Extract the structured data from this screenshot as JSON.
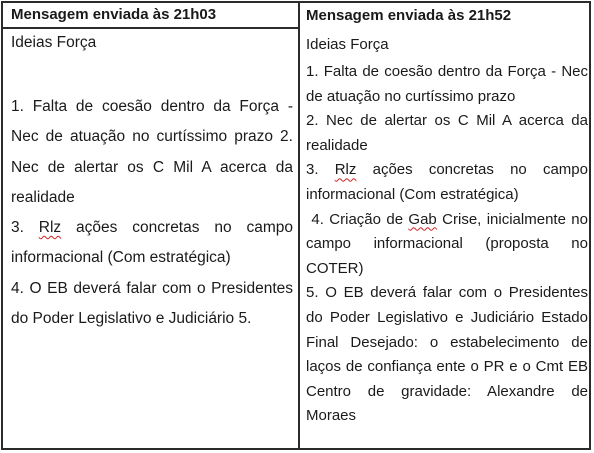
{
  "left_column": {
    "header": "Mensagem enviada às 21h03",
    "subtitle": "Ideias Força",
    "item_1_2": "1. Falta de coesão dentro da Força - Nec de atuação no curtíssimo prazo 2. Nec de alertar os C Mil A acerca da realidade",
    "item_3_prefix": "3. ",
    "item_3_squiggle": "Rlz",
    "item_3_rest": " ações concretas no campo informacional (Com estratégica)",
    "item_4": "4. O EB deverá falar com o Presidentes do Poder Legislativo e Judiciário 5."
  },
  "right_column": {
    "header": "Mensagem enviada às 21h52",
    "subtitle": "Ideias Força",
    "item_1": "1. Falta de coesão dentro da Força - Nec de atuação no curtíssimo prazo",
    "item_2": "2. Nec de alertar os C Mil A acerca da realidade",
    "item_3_prefix": "3. ",
    "item_3_squiggle": "Rlz",
    "item_3_rest": " ações concretas no campo informacional (Com estratégica)",
    "item_4_prefix": " 4. Criação de ",
    "item_4_squiggle": "Gab",
    "item_4_rest": " Crise, inicialmente no campo informacional (proposta no COTER)",
    "item_5": "5. O EB deverá falar com o Presidentes do Poder Legislativo e Judiciário Estado Final Desejado: o estabelecimento de laços de confiança ente o PR e o Cmt EB Centro de gravidade: Alexandre de Moraes"
  }
}
